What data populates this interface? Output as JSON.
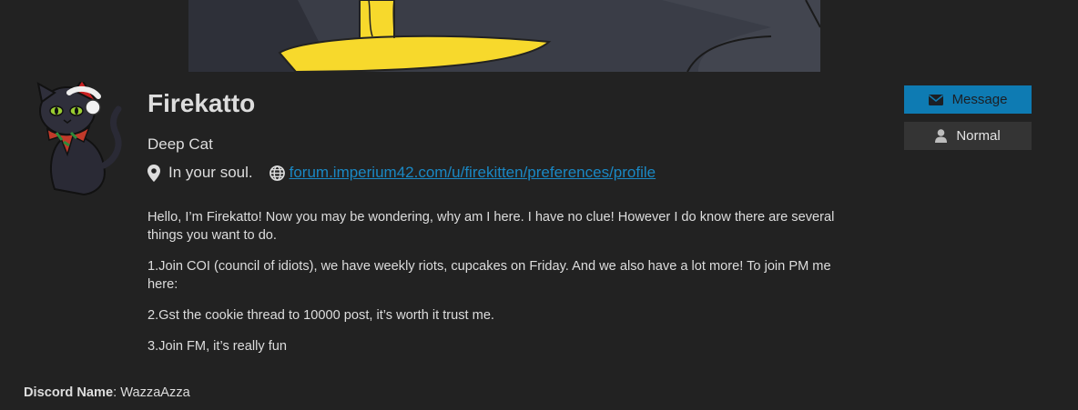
{
  "profile": {
    "username": "Firekatto",
    "title": "Deep Cat",
    "location": "In your soul.",
    "website": "forum.imperium42.com/u/firekitten/preferences/profile"
  },
  "bio": [
    "Hello, I’m Firekatto! Now you may be wondering, why am I here. I have no clue! However I do know there are several things you want to do.",
    "1.Join COI (council of idiots), we have weekly riots, cupcakes on Friday. And we also have a lot more! To join PM me here:",
    "2.Gst the cookie thread to 10000 post, it’s worth it trust me.",
    "3.Join FM, it’s really fun"
  ],
  "fields": {
    "discord_label": "Discord Name",
    "discord_value": ": WazzaAzza"
  },
  "actions": {
    "message_label": "Message",
    "notification_label": "Normal"
  },
  "icons": {
    "location": "map-marker-icon",
    "website": "globe-icon",
    "message": "envelope-icon",
    "notification": "user-icon"
  },
  "colors": {
    "background": "#222222",
    "primary": "#0e7bb3",
    "link": "#1a88c4",
    "secondary_button": "#343434"
  }
}
